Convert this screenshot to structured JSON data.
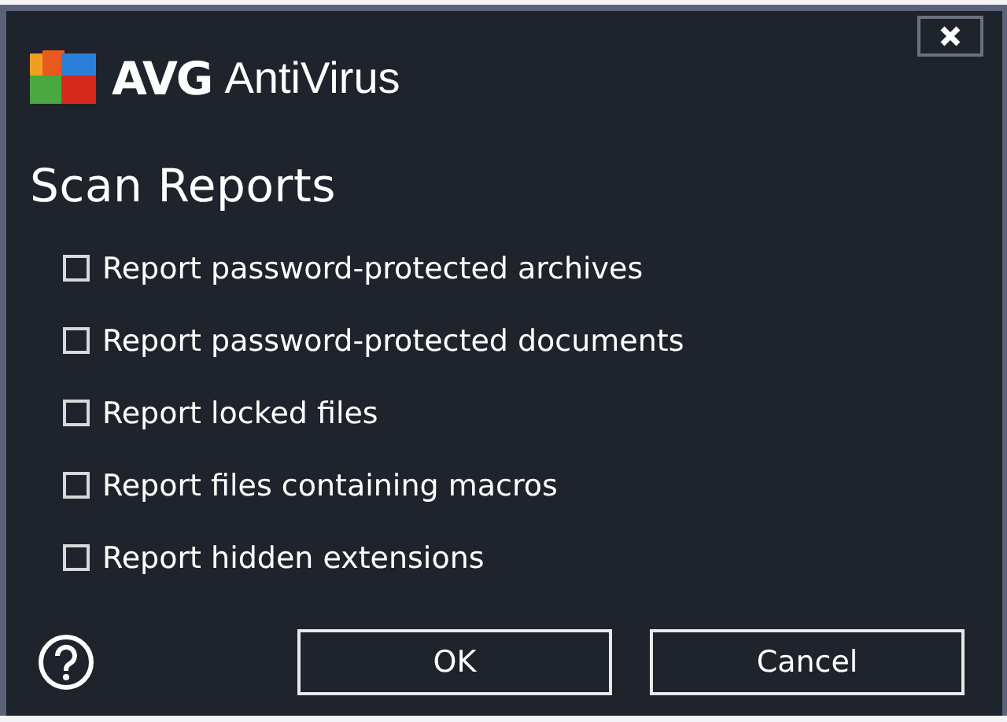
{
  "window": {
    "brand": "AVG",
    "product": "AntiVirus"
  },
  "title": "Scan Reports",
  "options": [
    {
      "label": "Report password-protected archives",
      "checked": false
    },
    {
      "label": "Report password-protected documents",
      "checked": false
    },
    {
      "label": "Report locked files",
      "checked": false
    },
    {
      "label": "Report files containing macros",
      "checked": false
    },
    {
      "label": "Report hidden extensions",
      "checked": false
    }
  ],
  "buttons": [
    "OK",
    "Cancel"
  ]
}
